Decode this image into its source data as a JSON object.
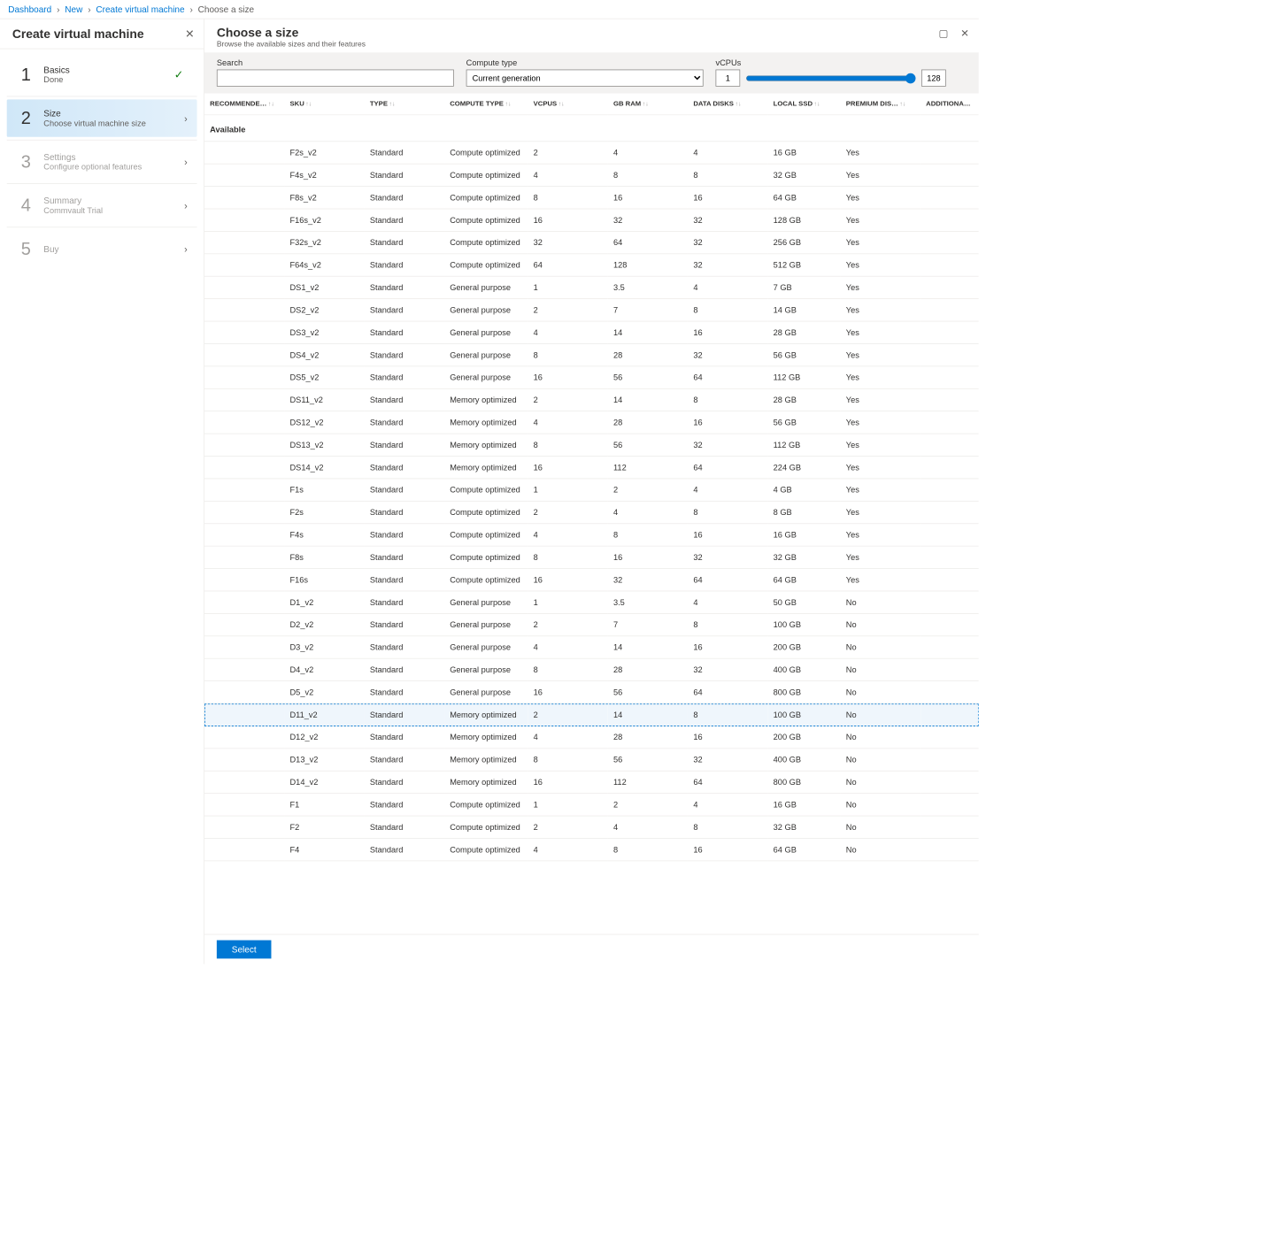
{
  "breadcrumbs": {
    "items": [
      "Dashboard",
      "New",
      "Create virtual machine",
      "Choose a size"
    ]
  },
  "left": {
    "title": "Create virtual machine",
    "steps": [
      {
        "num": "1",
        "title": "Basics",
        "sub": "Done",
        "state": "done"
      },
      {
        "num": "2",
        "title": "Size",
        "sub": "Choose virtual machine size",
        "state": "active"
      },
      {
        "num": "3",
        "title": "Settings",
        "sub": "Configure optional features",
        "state": "pending"
      },
      {
        "num": "4",
        "title": "Summary",
        "sub": "Commvault Trial",
        "state": "pending"
      },
      {
        "num": "5",
        "title": "Buy",
        "sub": "",
        "state": "pending"
      }
    ]
  },
  "right": {
    "title": "Choose a size",
    "sub": "Browse the available sizes and their features"
  },
  "filters": {
    "search_label": "Search",
    "search_value": "",
    "compute_type_label": "Compute type",
    "compute_type_value": "Current generation",
    "vcpu_label": "vCPUs",
    "vcpu_min": "1",
    "vcpu_max": "128"
  },
  "table": {
    "headers": [
      "RECOMMENDE…",
      "SKU",
      "TYPE",
      "COMPUTE TYPE",
      "VCPUS",
      "GB RAM",
      "DATA DISKS",
      "LOCAL SSD",
      "PREMIUM DIS…",
      "ADDITIONAL F…"
    ],
    "section_label": "Available",
    "selected_sku": "D11_v2",
    "rows": [
      {
        "sku": "F2s_v2",
        "type": "Standard",
        "ctype": "Compute optimized",
        "vcpus": "2",
        "ram": "4",
        "disks": "4",
        "ssd": "16 GB",
        "premium": "Yes"
      },
      {
        "sku": "F4s_v2",
        "type": "Standard",
        "ctype": "Compute optimized",
        "vcpus": "4",
        "ram": "8",
        "disks": "8",
        "ssd": "32 GB",
        "premium": "Yes"
      },
      {
        "sku": "F8s_v2",
        "type": "Standard",
        "ctype": "Compute optimized",
        "vcpus": "8",
        "ram": "16",
        "disks": "16",
        "ssd": "64 GB",
        "premium": "Yes"
      },
      {
        "sku": "F16s_v2",
        "type": "Standard",
        "ctype": "Compute optimized",
        "vcpus": "16",
        "ram": "32",
        "disks": "32",
        "ssd": "128 GB",
        "premium": "Yes"
      },
      {
        "sku": "F32s_v2",
        "type": "Standard",
        "ctype": "Compute optimized",
        "vcpus": "32",
        "ram": "64",
        "disks": "32",
        "ssd": "256 GB",
        "premium": "Yes"
      },
      {
        "sku": "F64s_v2",
        "type": "Standard",
        "ctype": "Compute optimized",
        "vcpus": "64",
        "ram": "128",
        "disks": "32",
        "ssd": "512 GB",
        "premium": "Yes"
      },
      {
        "sku": "DS1_v2",
        "type": "Standard",
        "ctype": "General purpose",
        "vcpus": "1",
        "ram": "3.5",
        "disks": "4",
        "ssd": "7 GB",
        "premium": "Yes"
      },
      {
        "sku": "DS2_v2",
        "type": "Standard",
        "ctype": "General purpose",
        "vcpus": "2",
        "ram": "7",
        "disks": "8",
        "ssd": "14 GB",
        "premium": "Yes"
      },
      {
        "sku": "DS3_v2",
        "type": "Standard",
        "ctype": "General purpose",
        "vcpus": "4",
        "ram": "14",
        "disks": "16",
        "ssd": "28 GB",
        "premium": "Yes"
      },
      {
        "sku": "DS4_v2",
        "type": "Standard",
        "ctype": "General purpose",
        "vcpus": "8",
        "ram": "28",
        "disks": "32",
        "ssd": "56 GB",
        "premium": "Yes"
      },
      {
        "sku": "DS5_v2",
        "type": "Standard",
        "ctype": "General purpose",
        "vcpus": "16",
        "ram": "56",
        "disks": "64",
        "ssd": "112 GB",
        "premium": "Yes"
      },
      {
        "sku": "DS11_v2",
        "type": "Standard",
        "ctype": "Memory optimized",
        "vcpus": "2",
        "ram": "14",
        "disks": "8",
        "ssd": "28 GB",
        "premium": "Yes"
      },
      {
        "sku": "DS12_v2",
        "type": "Standard",
        "ctype": "Memory optimized",
        "vcpus": "4",
        "ram": "28",
        "disks": "16",
        "ssd": "56 GB",
        "premium": "Yes"
      },
      {
        "sku": "DS13_v2",
        "type": "Standard",
        "ctype": "Memory optimized",
        "vcpus": "8",
        "ram": "56",
        "disks": "32",
        "ssd": "112 GB",
        "premium": "Yes"
      },
      {
        "sku": "DS14_v2",
        "type": "Standard",
        "ctype": "Memory optimized",
        "vcpus": "16",
        "ram": "112",
        "disks": "64",
        "ssd": "224 GB",
        "premium": "Yes"
      },
      {
        "sku": "F1s",
        "type": "Standard",
        "ctype": "Compute optimized",
        "vcpus": "1",
        "ram": "2",
        "disks": "4",
        "ssd": "4 GB",
        "premium": "Yes"
      },
      {
        "sku": "F2s",
        "type": "Standard",
        "ctype": "Compute optimized",
        "vcpus": "2",
        "ram": "4",
        "disks": "8",
        "ssd": "8 GB",
        "premium": "Yes"
      },
      {
        "sku": "F4s",
        "type": "Standard",
        "ctype": "Compute optimized",
        "vcpus": "4",
        "ram": "8",
        "disks": "16",
        "ssd": "16 GB",
        "premium": "Yes"
      },
      {
        "sku": "F8s",
        "type": "Standard",
        "ctype": "Compute optimized",
        "vcpus": "8",
        "ram": "16",
        "disks": "32",
        "ssd": "32 GB",
        "premium": "Yes"
      },
      {
        "sku": "F16s",
        "type": "Standard",
        "ctype": "Compute optimized",
        "vcpus": "16",
        "ram": "32",
        "disks": "64",
        "ssd": "64 GB",
        "premium": "Yes"
      },
      {
        "sku": "D1_v2",
        "type": "Standard",
        "ctype": "General purpose",
        "vcpus": "1",
        "ram": "3.5",
        "disks": "4",
        "ssd": "50 GB",
        "premium": "No"
      },
      {
        "sku": "D2_v2",
        "type": "Standard",
        "ctype": "General purpose",
        "vcpus": "2",
        "ram": "7",
        "disks": "8",
        "ssd": "100 GB",
        "premium": "No"
      },
      {
        "sku": "D3_v2",
        "type": "Standard",
        "ctype": "General purpose",
        "vcpus": "4",
        "ram": "14",
        "disks": "16",
        "ssd": "200 GB",
        "premium": "No"
      },
      {
        "sku": "D4_v2",
        "type": "Standard",
        "ctype": "General purpose",
        "vcpus": "8",
        "ram": "28",
        "disks": "32",
        "ssd": "400 GB",
        "premium": "No"
      },
      {
        "sku": "D5_v2",
        "type": "Standard",
        "ctype": "General purpose",
        "vcpus": "16",
        "ram": "56",
        "disks": "64",
        "ssd": "800 GB",
        "premium": "No"
      },
      {
        "sku": "D11_v2",
        "type": "Standard",
        "ctype": "Memory optimized",
        "vcpus": "2",
        "ram": "14",
        "disks": "8",
        "ssd": "100 GB",
        "premium": "No"
      },
      {
        "sku": "D12_v2",
        "type": "Standard",
        "ctype": "Memory optimized",
        "vcpus": "4",
        "ram": "28",
        "disks": "16",
        "ssd": "200 GB",
        "premium": "No"
      },
      {
        "sku": "D13_v2",
        "type": "Standard",
        "ctype": "Memory optimized",
        "vcpus": "8",
        "ram": "56",
        "disks": "32",
        "ssd": "400 GB",
        "premium": "No"
      },
      {
        "sku": "D14_v2",
        "type": "Standard",
        "ctype": "Memory optimized",
        "vcpus": "16",
        "ram": "112",
        "disks": "64",
        "ssd": "800 GB",
        "premium": "No"
      },
      {
        "sku": "F1",
        "type": "Standard",
        "ctype": "Compute optimized",
        "vcpus": "1",
        "ram": "2",
        "disks": "4",
        "ssd": "16 GB",
        "premium": "No"
      },
      {
        "sku": "F2",
        "type": "Standard",
        "ctype": "Compute optimized",
        "vcpus": "2",
        "ram": "4",
        "disks": "8",
        "ssd": "32 GB",
        "premium": "No"
      },
      {
        "sku": "F4",
        "type": "Standard",
        "ctype": "Compute optimized",
        "vcpus": "4",
        "ram": "8",
        "disks": "16",
        "ssd": "64 GB",
        "premium": "No"
      }
    ]
  },
  "footer": {
    "select_label": "Select"
  }
}
